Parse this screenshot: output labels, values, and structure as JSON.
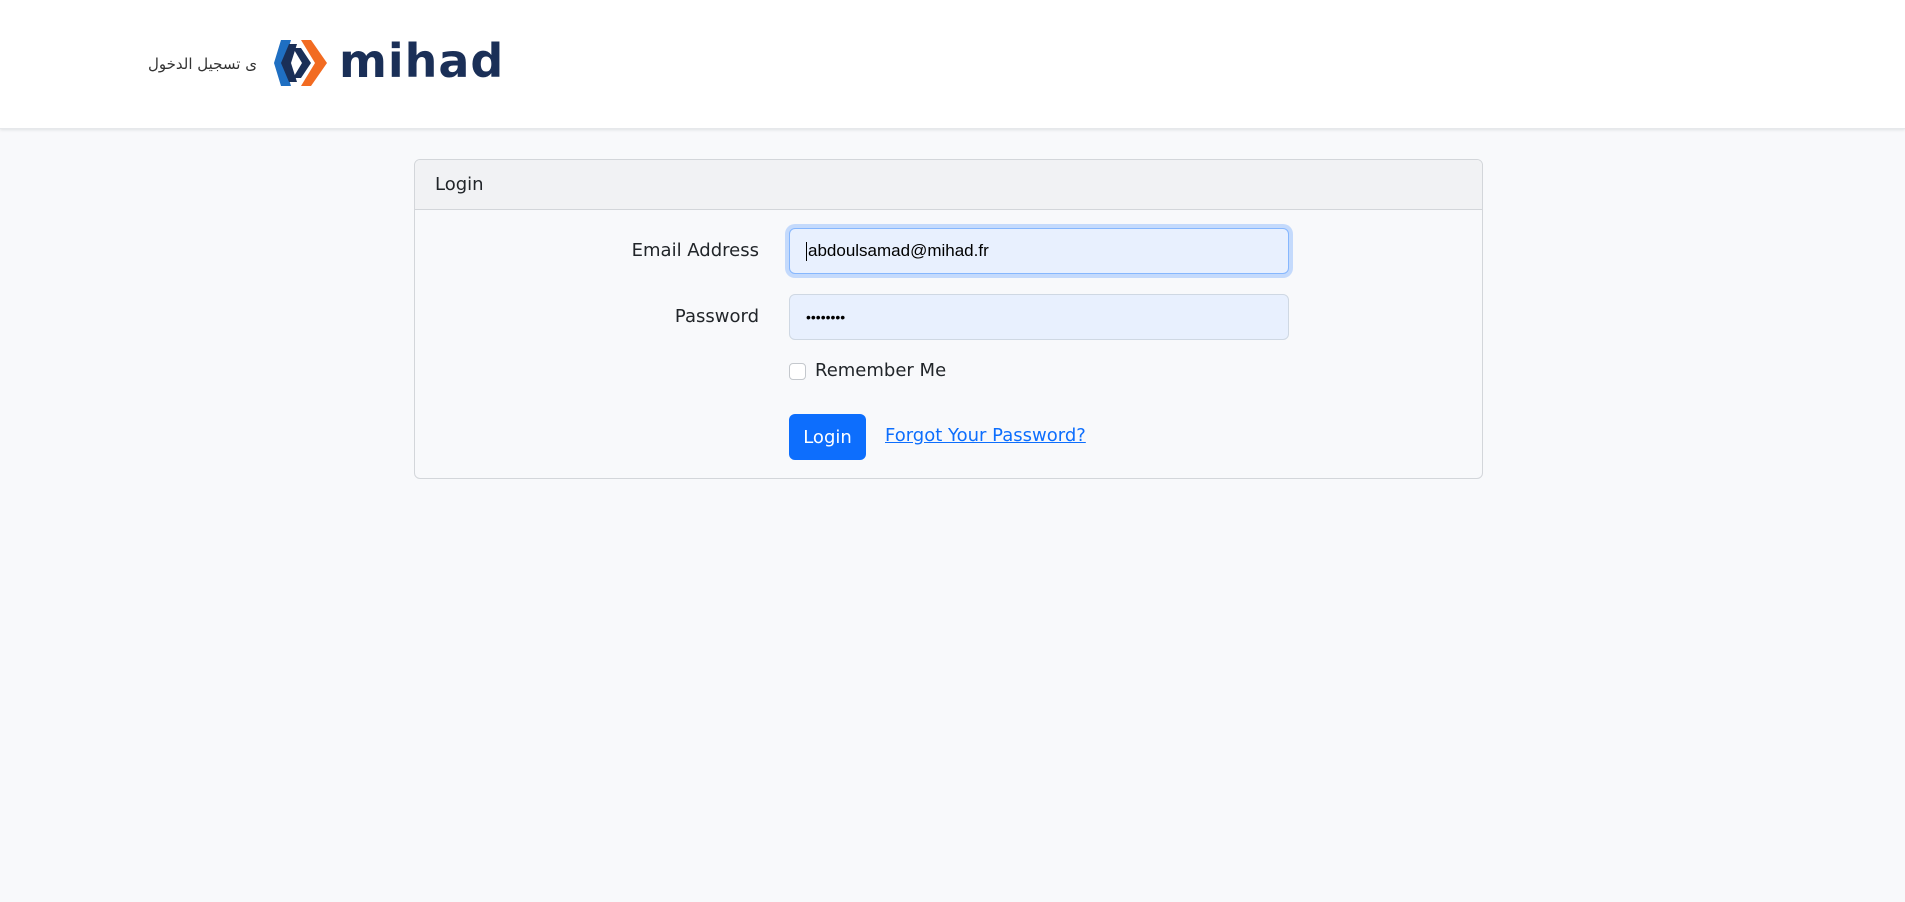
{
  "navbar": {
    "brand_arabic": "ى تسجيل الدخول",
    "logo_text": "mihad",
    "logo_colors": {
      "blue": "#1f6fc2",
      "orange": "#f26b21",
      "navy": "#1a2f57"
    }
  },
  "login_card": {
    "header": "Login",
    "email": {
      "label": "Email Address",
      "value": "abdoulsamad@mihad.fr"
    },
    "password": {
      "label": "Password",
      "value": "••••••••"
    },
    "remember": {
      "label": "Remember Me",
      "checked": false
    },
    "submit_label": "Login",
    "forgot_label": "Forgot Your Password?"
  },
  "colors": {
    "primary": "#0d6efd",
    "autofill_bg": "#e8f0fe",
    "page_bg": "#f8f9fb"
  }
}
